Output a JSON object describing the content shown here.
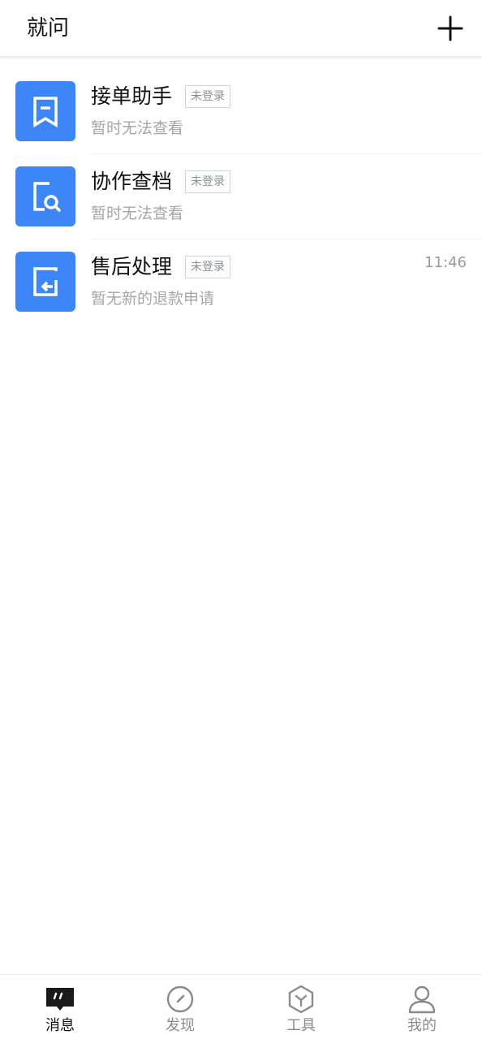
{
  "header": {
    "title": "就问",
    "add_icon": "plus-icon"
  },
  "messages": [
    {
      "title": "接单助手",
      "badge": "未登录",
      "preview": "暂时无法查看",
      "time": "",
      "icon": "bookmark-icon",
      "icon_bg": "#3d86f8"
    },
    {
      "title": "协作查档",
      "badge": "未登录",
      "preview": "暂时无法查看",
      "time": "",
      "icon": "document-search-icon",
      "icon_bg": "#3d86f8"
    },
    {
      "title": "售后处理",
      "badge": "未登录",
      "preview": "暂无新的退款申请",
      "time": "11:46",
      "icon": "return-icon",
      "icon_bg": "#3d86f8"
    }
  ],
  "tabbar": {
    "active_index": 0,
    "tabs": [
      {
        "label": "消息",
        "icon": "chat-bubble-icon"
      },
      {
        "label": "发现",
        "icon": "compass-icon"
      },
      {
        "label": "工具",
        "icon": "cube-icon"
      },
      {
        "label": "我的",
        "icon": "user-icon"
      }
    ]
  },
  "colors": {
    "accent": "#3d86f8",
    "text_primary": "#111111",
    "text_secondary": "#a6a6a6",
    "badge_border": "#cdd3da"
  }
}
